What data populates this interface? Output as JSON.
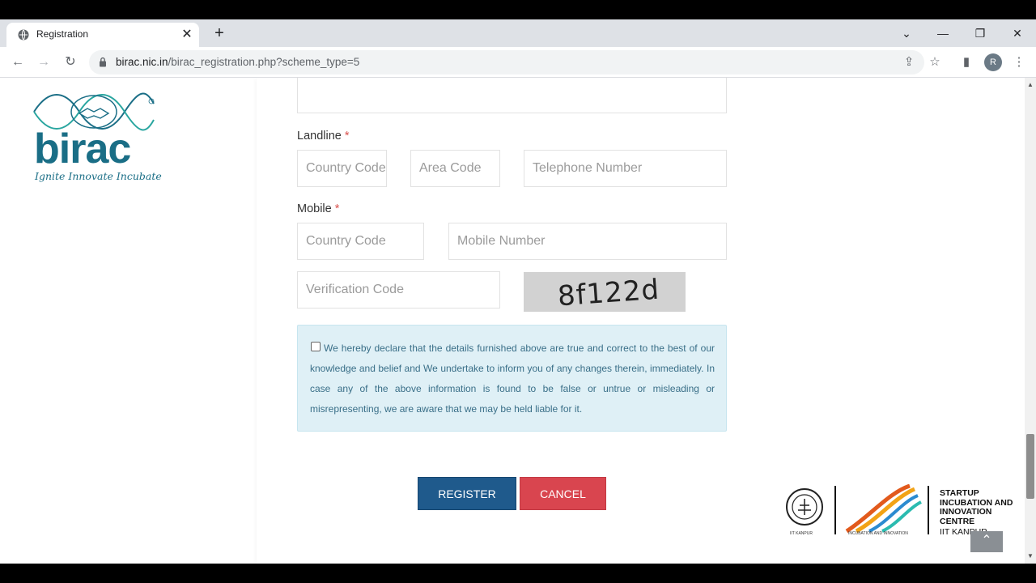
{
  "browser": {
    "tab_title": "Registration",
    "url_host": "birac.nic.in",
    "url_path": "/birac_registration.php?scheme_type=5",
    "profile_initial": "R"
  },
  "logo": {
    "wordmark": "birac",
    "tagline": "Ignite Innovate Incubate"
  },
  "form": {
    "landline_label": "Landline",
    "mobile_label": "Mobile",
    "required_mark": "*",
    "landline_country_code_placeholder": "Country Code",
    "area_code_placeholder": "Area Code",
    "telephone_placeholder": "Telephone Number",
    "mobile_country_code_placeholder": "Country Code",
    "mobile_number_placeholder": "Mobile Number",
    "verification_placeholder": "Verification Code",
    "captcha_text": "8f122d",
    "declaration": "We hereby declare that the details furnished above are true and correct to the best of our knowledge and belief and We undertake to inform you of any changes therein, immediately. In case any of the above information is found to be false or untrue or misleading or misrepresenting, we are aware that we may be held liable for it.",
    "register_label": "REGISTER",
    "cancel_label": "CANCEL"
  },
  "footer": {
    "centre_title_1": "STARTUP",
    "centre_title_2": "INCUBATION AND",
    "centre_title_3": "INNOVATION",
    "centre_title_4": "CENTRE",
    "centre_sub": "IIT KANPUR",
    "small_left": "IIT KANPUR",
    "small_mid": "INCUBATION AND INNOVATION"
  },
  "colors": {
    "brand_teal": "#1a6e86",
    "register_blue": "#1f5a8c",
    "cancel_red": "#d9454f",
    "declare_bg": "#dff0f6"
  }
}
